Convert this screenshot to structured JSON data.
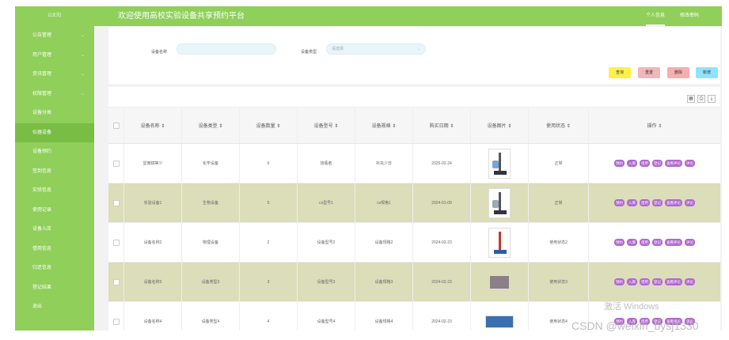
{
  "header": {
    "logo": "Ω太阳",
    "title": "欢迎使用高校实验设备共享预约平台",
    "links": [
      {
        "label": "个人信息"
      },
      {
        "label": "修改密码"
      }
    ]
  },
  "sidebar": {
    "items": [
      {
        "label": "公告管理",
        "has_submenu": true
      },
      {
        "label": "用户管理",
        "has_submenu": true
      },
      {
        "label": "资讯管理",
        "has_submenu": true
      },
      {
        "label": "权限管理",
        "has_submenu": true
      },
      {
        "label": "设备分类"
      },
      {
        "label": "仪器设备",
        "active": true
      },
      {
        "label": "设备预约"
      },
      {
        "label": "签到信息"
      },
      {
        "label": "实验信息"
      },
      {
        "label": "使用记录"
      },
      {
        "label": "设备入库"
      },
      {
        "label": "借用信息"
      },
      {
        "label": "归还信息"
      },
      {
        "label": "登记结果"
      },
      {
        "label": "退出"
      }
    ]
  },
  "search": {
    "name_label": "设备名称",
    "name_value": "",
    "type_label": "设备类型",
    "type_placeholder": "请选择",
    "buttons": {
      "query": "查询",
      "reset": "重置",
      "delete": "删除",
      "add": "新增"
    }
  },
  "table": {
    "columns": [
      "设备名称 ⇕",
      "设备类型 ⇕",
      "设备数量 ⇕",
      "设备型号 ⇕",
      "设备规格 ⇕",
      "购买日期 ⇕",
      "设备图片 ⇕",
      "使用状态 ⇕",
      "操作 ⇕"
    ],
    "ops": [
      "预约",
      "入库",
      "借用",
      "登记",
      "查看评论",
      "评论"
    ],
    "rows": [
      {
        "name": "显微镜等少",
        "type": "化学设备",
        "qty": "6",
        "model": "烧瓶者",
        "spec": "补充少日",
        "date": "2025-02-24",
        "status": "正常"
      },
      {
        "name": "实验设备1",
        "type": "生物设备",
        "qty": "5",
        "model": "cs型号1",
        "spec": "cs规格1",
        "date": "2024-01-09",
        "status": "正常"
      },
      {
        "name": "设备名称2",
        "type": "物理设备",
        "qty": "2",
        "model": "设备型号2",
        "spec": "设备规格2",
        "date": "2024-02-23",
        "status": "使用状态2"
      },
      {
        "name": "设备名称3",
        "type": "设备类型3",
        "qty": "3",
        "model": "设备型号3",
        "spec": "设备规格3",
        "date": "2024-02-23",
        "status": "使用状态3"
      },
      {
        "name": "设备名称4",
        "type": "设备类型4",
        "qty": "4",
        "model": "设备型号4",
        "spec": "设备规格4",
        "date": "2024-02-23",
        "status": "使用状态4"
      }
    ]
  },
  "watermarks": {
    "activate": "激活 Windows",
    "csdn": "CSDN @weixin_bysj1330"
  },
  "colors": {
    "header_green": "#8fcf5a",
    "row_highlight": "#dcddb9",
    "op_button": "#b069cf",
    "query_btn": "#fff04a",
    "reset_btn": "#f1b6bb",
    "delete_btn": "#f6aeae",
    "add_btn": "#8fe3ff"
  }
}
